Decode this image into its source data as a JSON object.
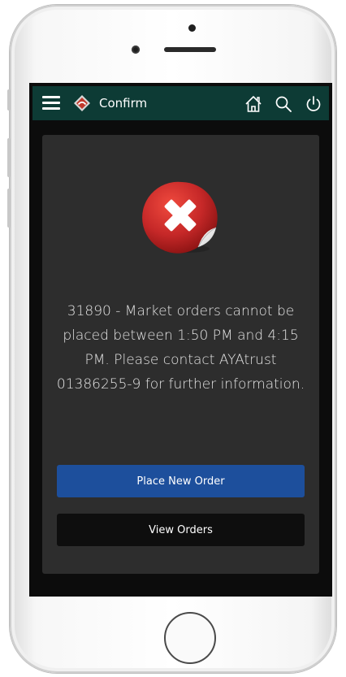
{
  "appbar": {
    "title": "Confirm",
    "background": "#0d3b35",
    "icons": [
      "menu-icon",
      "logo-icon",
      "home-icon",
      "search-icon",
      "power-icon"
    ]
  },
  "dialog": {
    "icon": "error-x-icon",
    "icon_color": "#c62828",
    "message": "31890 - Market orders cannot be placed between 1:50 PM and 4:15 PM. Please contact AYAtrust 01386255-9 for further information."
  },
  "actions": {
    "place_new_order": "Place New Order",
    "view_orders": "View Orders",
    "primary_color": "#1d4f9c"
  }
}
